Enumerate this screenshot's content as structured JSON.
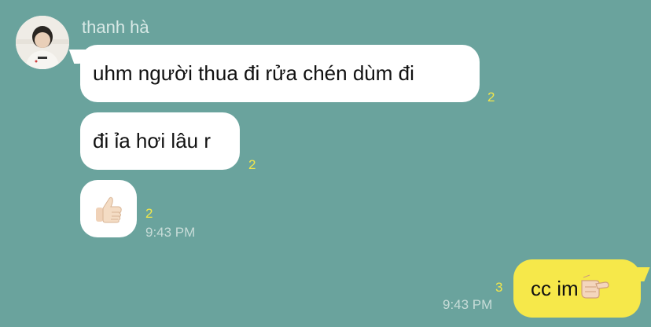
{
  "chat": {
    "sender_name": "thanh hà",
    "messages": [
      {
        "text": "uhm người thua đi rửa chén dùm đi",
        "read_count": "2"
      },
      {
        "text": "đi ỉa hơi lâu r",
        "read_count": "2"
      },
      {
        "emoji": "thumbs-up",
        "read_count": "2",
        "time": "9:43 PM"
      }
    ],
    "my_message": {
      "text": "cc im",
      "emoji": "pointing-hand",
      "read_count": "3",
      "time": "9:43 PM"
    }
  },
  "colors": {
    "background": "#6aa39d",
    "incoming_bubble": "#ffffff",
    "outgoing_bubble": "#f6e84a",
    "read_count": "#f1e64b"
  }
}
